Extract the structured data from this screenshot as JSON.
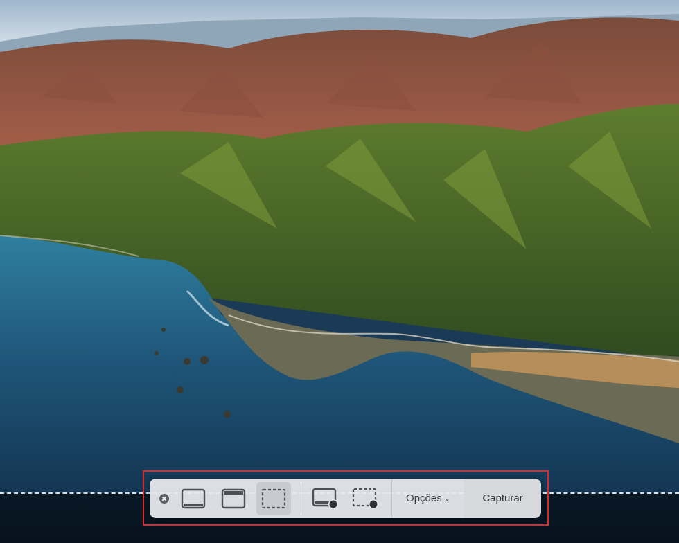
{
  "toolbar": {
    "close_icon": "close-icon",
    "tools": [
      {
        "name": "capture-entire-screen",
        "icon": "entire-screen-icon"
      },
      {
        "name": "capture-window",
        "icon": "window-icon"
      },
      {
        "name": "capture-selection",
        "icon": "selection-icon",
        "selected": true
      },
      {
        "name": "record-entire-screen",
        "icon": "record-screen-icon"
      },
      {
        "name": "record-selection",
        "icon": "record-selection-icon"
      }
    ],
    "options_label": "Opções",
    "options_chevron": "⌄",
    "capture_label": "Capturar"
  },
  "colors": {
    "highlight_border": "#e3262a",
    "toolbar_bg": "#e8eaee",
    "selected_tool_bg": "#c8cacf"
  }
}
